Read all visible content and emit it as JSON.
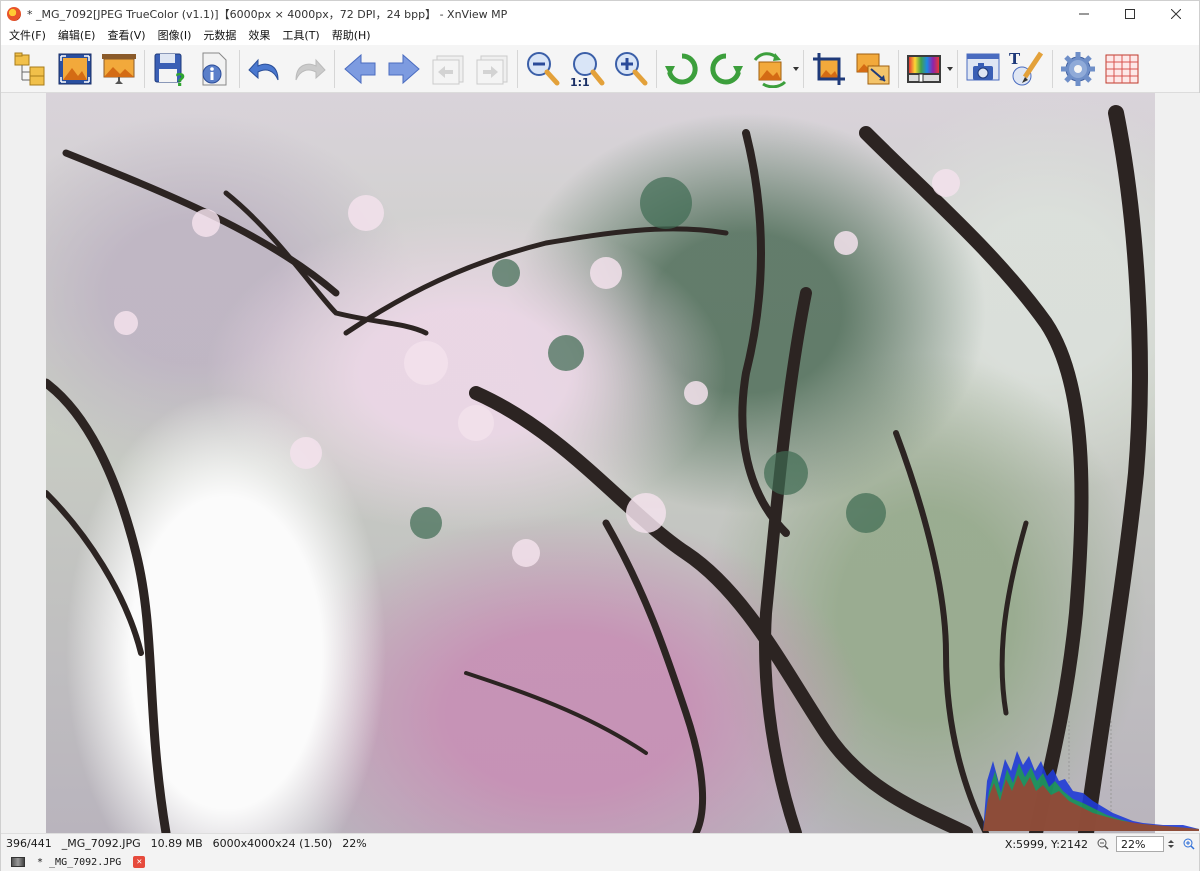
{
  "window": {
    "title": "* _MG_7092[JPEG TrueColor (v1.1)]【6000px × 4000px，72 DPI，24 bpp】 - XnView MP",
    "controls": {
      "minimize": "—",
      "maximize": "☐",
      "close": "✕"
    }
  },
  "menu": {
    "items": [
      "文件(F)",
      "编辑(E)",
      "查看(V)",
      "图像(I)",
      "元数据",
      "效果",
      "工具(T)",
      "帮助(H)"
    ]
  },
  "toolbar": {
    "buttons": [
      {
        "icon": "browser-folders-icon"
      },
      {
        "icon": "fullscreen-icon"
      },
      {
        "icon": "slideshow-icon"
      },
      {
        "icon": "save-icon"
      },
      {
        "icon": "properties-icon"
      },
      {
        "icon": "undo-icon"
      },
      {
        "icon": "redo-icon"
      },
      {
        "icon": "previous-image-icon"
      },
      {
        "icon": "next-image-icon"
      },
      {
        "icon": "first-image-icon"
      },
      {
        "icon": "last-image-icon"
      },
      {
        "icon": "zoom-out-icon"
      },
      {
        "icon": "zoom-100-icon",
        "label": "1:1"
      },
      {
        "icon": "zoom-in-icon"
      },
      {
        "icon": "rotate-left-icon"
      },
      {
        "icon": "rotate-right-icon"
      },
      {
        "icon": "flip-icon"
      },
      {
        "icon": "crop-icon"
      },
      {
        "icon": "resize-icon"
      },
      {
        "icon": "adjust-colors-icon"
      },
      {
        "icon": "screen-capture-icon"
      },
      {
        "icon": "add-text-icon",
        "label": "T"
      },
      {
        "icon": "settings-icon"
      },
      {
        "icon": "grid-icon"
      }
    ]
  },
  "status": {
    "index": "396/441",
    "filename": "_MG_7092.JPG",
    "filesize": "10.89 MB",
    "dimensions": "6000x4000x24 (1.50)",
    "zoom_percent": "22%",
    "cursor": "X:5999, Y:2142",
    "zoom_value": "22%"
  },
  "tabs": [
    {
      "label": "* _MG_7092.JPG",
      "close": "✕"
    }
  ],
  "colors": {
    "accent_blue": "#2f6fd8",
    "toolbar_bg": "#f5f5f5",
    "close_tab": "#e64a3c"
  }
}
